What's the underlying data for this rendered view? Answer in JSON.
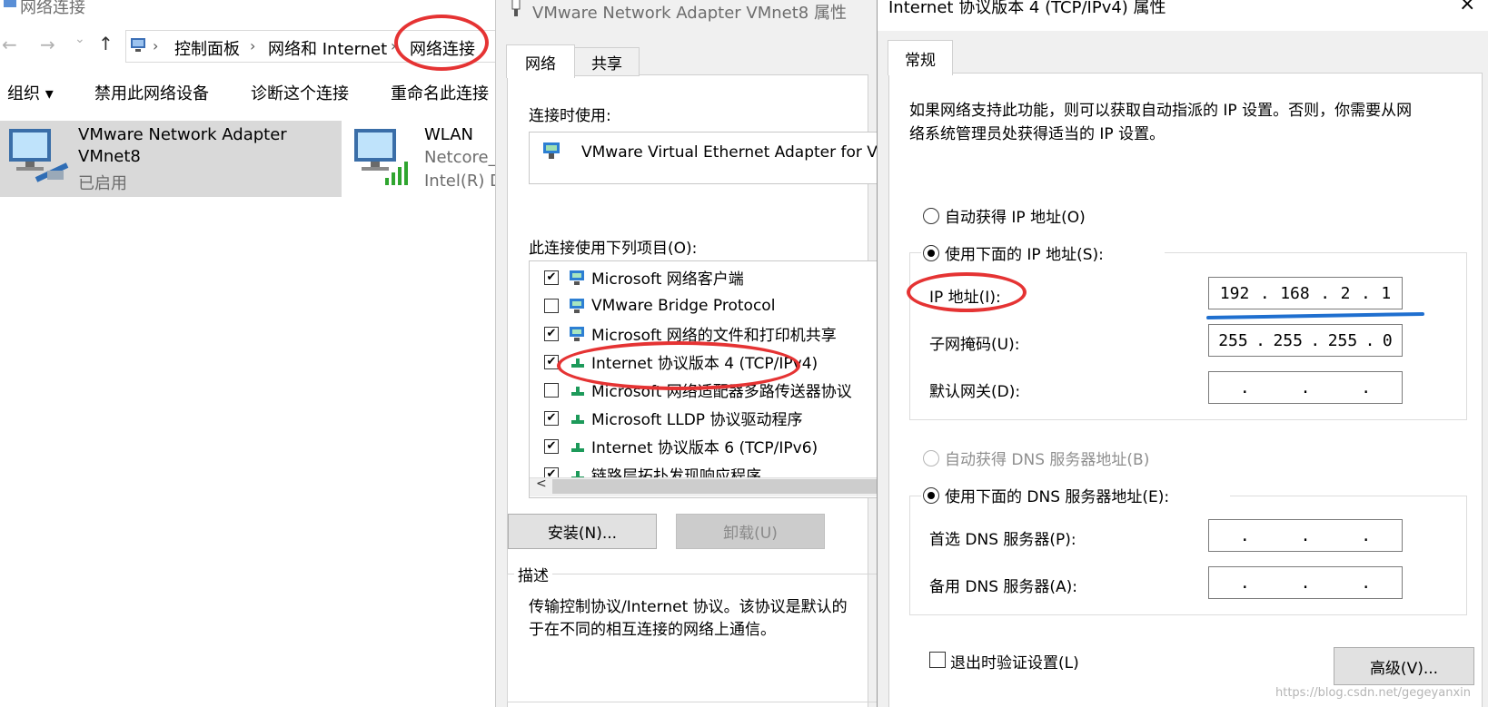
{
  "explorer": {
    "title": "网络连接",
    "nav": {
      "back": "←",
      "forward": "→",
      "recent": "⌄",
      "up": "↑"
    },
    "breadcrumb": [
      "控制面板",
      "网络和 Internet",
      "网络连接"
    ],
    "commands": [
      "组织 ▾",
      "禁用此网络设备",
      "诊断这个连接",
      "重命名此连接"
    ],
    "adapters": [
      {
        "name1": "VMware Network Adapter",
        "name2": "VMnet8",
        "status": "已启用"
      },
      {
        "name1": "WLAN",
        "name2": "Netcore_",
        "status": "Intel(R) D"
      }
    ]
  },
  "vmprops": {
    "title": "VMware Network Adapter VMnet8 属性",
    "tabs": [
      "网络",
      "共享"
    ],
    "connect_using_label": "连接时使用:",
    "adapter_value": "VMware Virtual Ethernet Adapter for V",
    "items_label": "此连接使用下列项目(O):",
    "items": [
      {
        "checked": "✔",
        "text": "Microsoft 网络客户端"
      },
      {
        "checked": "",
        "text": "VMware Bridge Protocol"
      },
      {
        "checked": "✔",
        "text": "Microsoft 网络的文件和打印机共享"
      },
      {
        "checked": "✔",
        "text": "Internet 协议版本 4 (TCP/IPv4)"
      },
      {
        "checked": "",
        "text": "Microsoft 网络适配器多路传送器协议"
      },
      {
        "checked": "✔",
        "text": "Microsoft LLDP 协议驱动程序"
      },
      {
        "checked": "✔",
        "text": "Internet 协议版本 6 (TCP/IPv6)"
      },
      {
        "checked": "✔",
        "text": "链路层拓扑发现响应程序"
      }
    ],
    "scroll_left": "<",
    "install_button": "安装(N)...",
    "uninstall_button": "卸载(U)",
    "description_label": "描述",
    "description_text_1": "传输控制协议/Internet 协议。该协议是默认的",
    "description_text_2": "于在不同的相互连接的网络上通信。"
  },
  "ipv4": {
    "title": "Internet 协议版本 4 (TCP/IPv4) 属性",
    "close": "×",
    "tab_general": "常规",
    "intro_1": "如果网络支持此功能，则可以获取自动指派的 IP 设置。否则，你需要从网",
    "intro_2": "络系统管理员处获得适当的 IP 设置。",
    "auto_ip_label": "自动获得 IP 地址(O)",
    "manual_ip_label": "使用下面的 IP 地址(S):",
    "ip_label": "IP 地址(I):",
    "ip_value": [
      "192",
      ".",
      "168",
      ".",
      "2",
      ".",
      "1"
    ],
    "subnet_label": "子网掩码(U):",
    "subnet_value": [
      "255",
      ".",
      "255",
      ".",
      "255",
      ".",
      "0"
    ],
    "gateway_label": "默认网关(D):",
    "gateway_value": [
      ".",
      ".",
      "."
    ],
    "auto_dns_label": "自动获得 DNS 服务器地址(B)",
    "manual_dns_label": "使用下面的 DNS 服务器地址(E):",
    "pref_dns_label": "首选 DNS 服务器(P):",
    "pref_dns_value": [
      ".",
      ".",
      "."
    ],
    "alt_dns_label": "备用 DNS 服务器(A):",
    "alt_dns_value": [
      ".",
      ".",
      "."
    ],
    "validate_label": "退出时验证设置(L)",
    "advanced_button": "高级(V)...",
    "watermark": "https://blog.csdn.net/gegeyanxin"
  },
  "colors": {
    "annotation_red": "#e53333",
    "annotation_blue": "#1f6fcf"
  }
}
